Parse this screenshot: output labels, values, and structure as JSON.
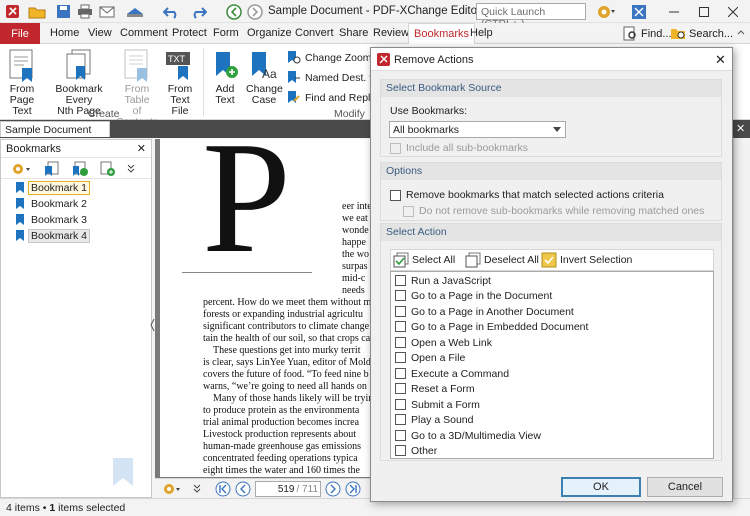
{
  "window": {
    "title": "Sample Document - PDF-XChange Editor",
    "quick_launch_placeholder": "Quick Launch (CTRL+.)",
    "find_label": "Find...",
    "search_label": "Search..."
  },
  "menu": {
    "file": "File",
    "items": [
      "Home",
      "View",
      "Comment",
      "Protect",
      "Form",
      "Organize",
      "Convert",
      "Share",
      "Review",
      "Bookmarks",
      "Help"
    ],
    "active": "Bookmarks"
  },
  "ribbon": {
    "create": {
      "label": "Create",
      "buttons": [
        {
          "l1": "From",
          "l2": "Page Text"
        },
        {
          "l1": "Bookmark Every",
          "l2": "Nth Page"
        },
        {
          "l1": "From Table",
          "l2": "of Contents"
        },
        {
          "l1": "From",
          "l2": "Text File"
        }
      ]
    },
    "modify": {
      "label": "Modify",
      "add_l1": "Add",
      "add_l2": "Text",
      "case_l1": "Change",
      "case_l2": "Case",
      "change_zoom": "Change Zoom",
      "named_dest": "Named Dest. to R",
      "find_replace": "Find and Replace"
    }
  },
  "doc_tab": {
    "label": "Sample Document"
  },
  "bookmarks_panel": {
    "title": "Bookmarks",
    "items": [
      "Bookmark 1",
      "Bookmark 2",
      "Bookmark 3",
      "Bookmark 4"
    ]
  },
  "status": {
    "count": "4",
    "items_word": "items",
    "bullet": "•",
    "selected_count": "1",
    "selected_word": "items selected"
  },
  "page_nav": {
    "current": "519",
    "total": "/ 711"
  },
  "document": {
    "drop_cap": "P",
    "right_lines": [
      "eer inte",
      "we eat",
      "wonde",
      "happe",
      "the wo",
      "surpas",
      "mid-c",
      "needs"
    ],
    "lines": [
      "percent. How do we meet them without m",
      "forests or expanding industrial agricultu",
      "significant contributors to climate change",
      "tain the health of our soil, so that crops ca",
      "These questions get into murky territ",
      "is clear, says LinYee Yuan, editor of Mold",
      "covers the future of food. “To feed nine b",
      "warns, “we’re going to need all hands on",
      "Many of those hands likely will be tryin",
      "to produce protein as the environmenta",
      "trial animal production becomes increa",
      "Livestock production represents about",
      "human-made greenhouse gas emissions",
      "concentrated feeding operations typica",
      "eight times the water and 160 times the"
    ]
  },
  "dialog": {
    "title": "Remove Actions",
    "source": {
      "header": "Select Bookmark Source",
      "use_label": "Use Bookmarks:",
      "selected": "All bookmarks",
      "include_sub": "Include all sub-bookmarks"
    },
    "options": {
      "header": "Options",
      "remove_match": "Remove bookmarks that match selected actions criteria",
      "no_remove_sub": "Do not remove sub-bookmarks while removing matched ones"
    },
    "select_action": {
      "header": "Select Action",
      "select_all": "Select All",
      "deselect_all": "Deselect All",
      "invert": "Invert Selection",
      "actions": [
        "Run a JavaScript",
        "Go to a Page in the Document",
        "Go to a Page in Another Document",
        "Go to a Page in Embedded Document",
        "Open a Web Link",
        "Open a File",
        "Execute a Command",
        "Reset a Form",
        "Submit a Form",
        "Play a Sound",
        "Go to a 3D/Multimedia View",
        "Other"
      ]
    },
    "ok": "OK",
    "cancel": "Cancel"
  },
  "colors": {
    "accent_red": "#c0282d",
    "bookmark_blue": "#1e73be",
    "dialog_bg": "#f0f0f0"
  }
}
